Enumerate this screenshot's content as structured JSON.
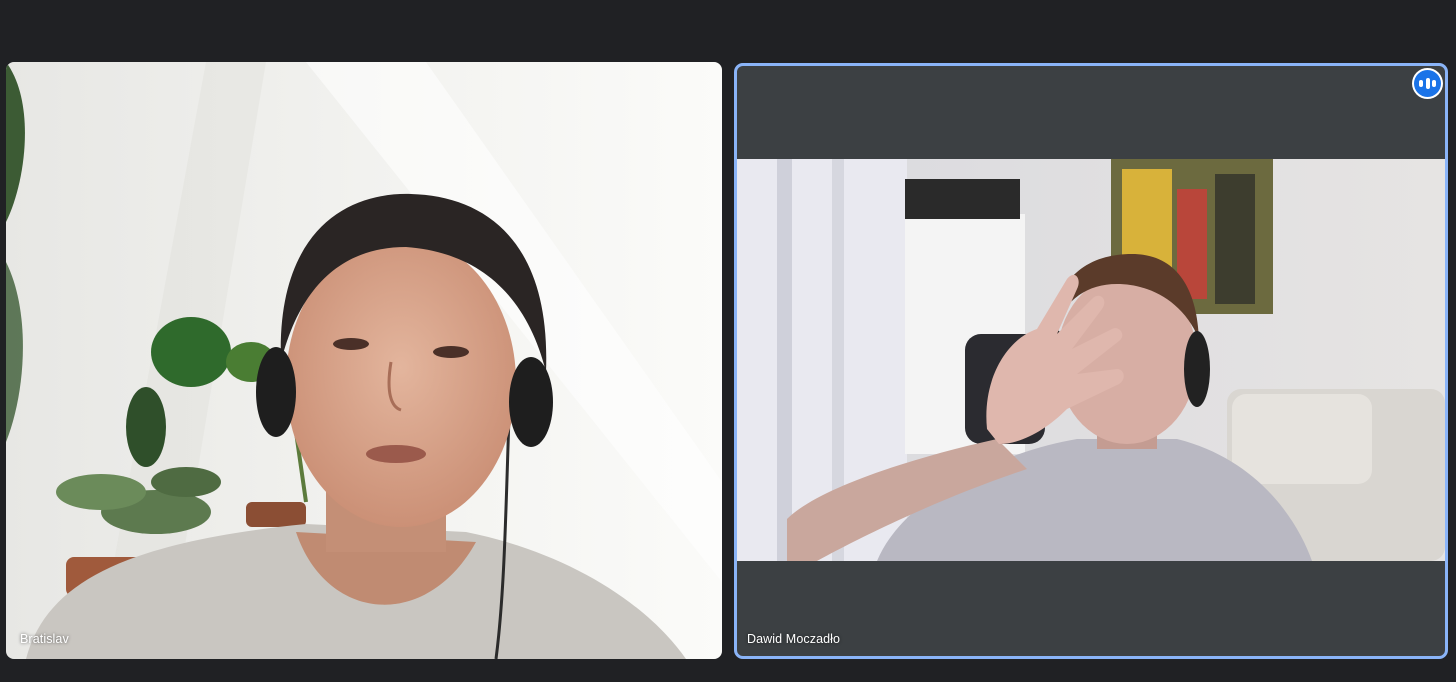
{
  "participants": [
    {
      "name": "Bratislav",
      "speaking": false
    },
    {
      "name": "Dawid Moczadło",
      "speaking": true
    }
  ],
  "colors": {
    "background": "#202124",
    "tile_background": "#3c4043",
    "active_speaker_border": "#8ab4f8",
    "speaking_indicator": "#1a73e8"
  },
  "icons": {
    "speaking_indicator": "audio-level-icon"
  }
}
